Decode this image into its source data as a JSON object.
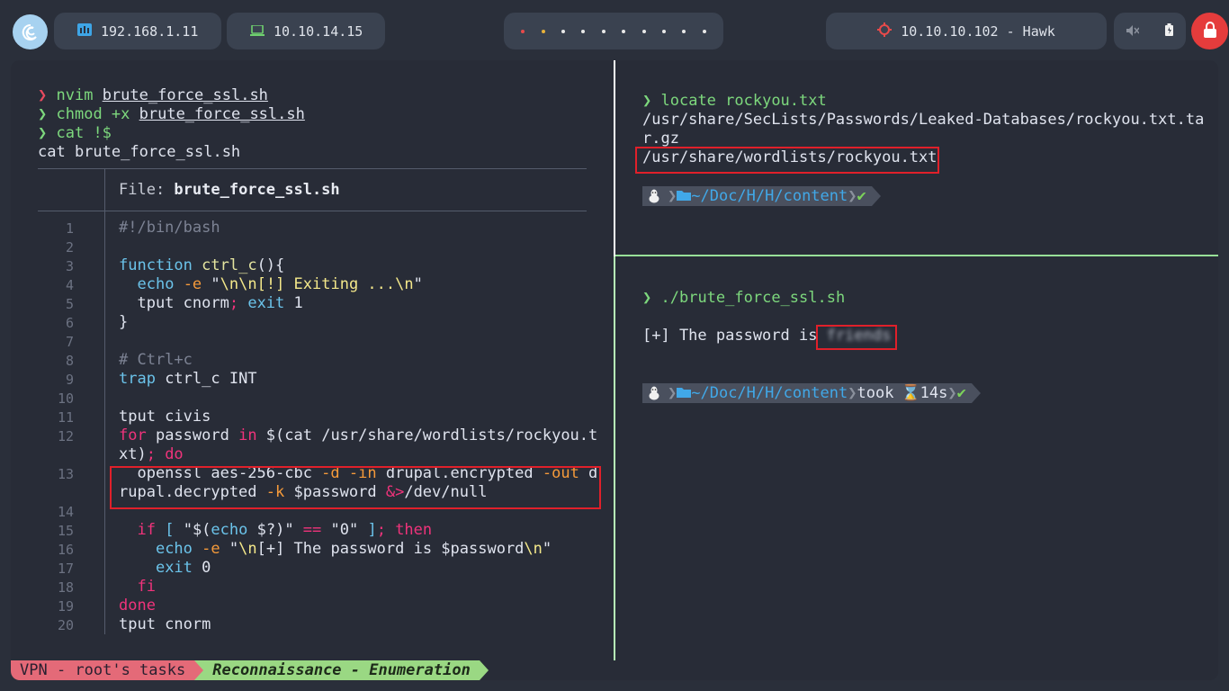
{
  "topbar": {
    "ip_local": "192.168.1.11",
    "ip_vpn": "10.10.14.15",
    "target": "10.10.10.102 - Hawk",
    "workspace_count": 10
  },
  "left_pane": {
    "cmd1": {
      "prompt": "❯",
      "text": "nvim ",
      "arg": "brute_force_ssl.sh"
    },
    "cmd2": {
      "prompt": "❯",
      "text": "chmod +x ",
      "arg": "brute_force_ssl.sh"
    },
    "cmd3": {
      "prompt": "❯",
      "text": "cat !$"
    },
    "expanded": "cat brute_force_ssl.sh",
    "file_label": "File: ",
    "file_name": "brute_force_ssl.sh",
    "line_numbers": [
      "1",
      "2",
      "3",
      "4",
      "5",
      "6",
      "7",
      "8",
      "9",
      "10",
      "11",
      "12",
      "",
      "13",
      "",
      "14",
      "15",
      "16",
      "17",
      "18",
      "19",
      "20"
    ]
  },
  "right_top": {
    "cmd": {
      "prompt": "❯",
      "text": "locate rockyou.txt"
    },
    "out1": "/usr/share/SecLists/Passwords/Leaked-Databases/rockyou.txt.ta",
    "out2": "r.gz",
    "out3": "/usr/share/wordlists/rockyou.txt",
    "path": "~/Doc/H/H/content"
  },
  "right_bottom": {
    "cmd": {
      "prompt": "❯",
      "text": "./brute_force_ssl.sh"
    },
    "result_label": "[+] The password is ",
    "result_value": "friends",
    "path": "~/Doc/H/H/content",
    "took_label": "took",
    "took_value": "14s"
  },
  "statusbar": {
    "left": "VPN - root's tasks",
    "right": "Reconnaissance - Enumeration"
  },
  "colors": {
    "accent_red": "#e0202a",
    "prompt_green": "#7dd87d",
    "prompt_red": "#e84a5f"
  }
}
